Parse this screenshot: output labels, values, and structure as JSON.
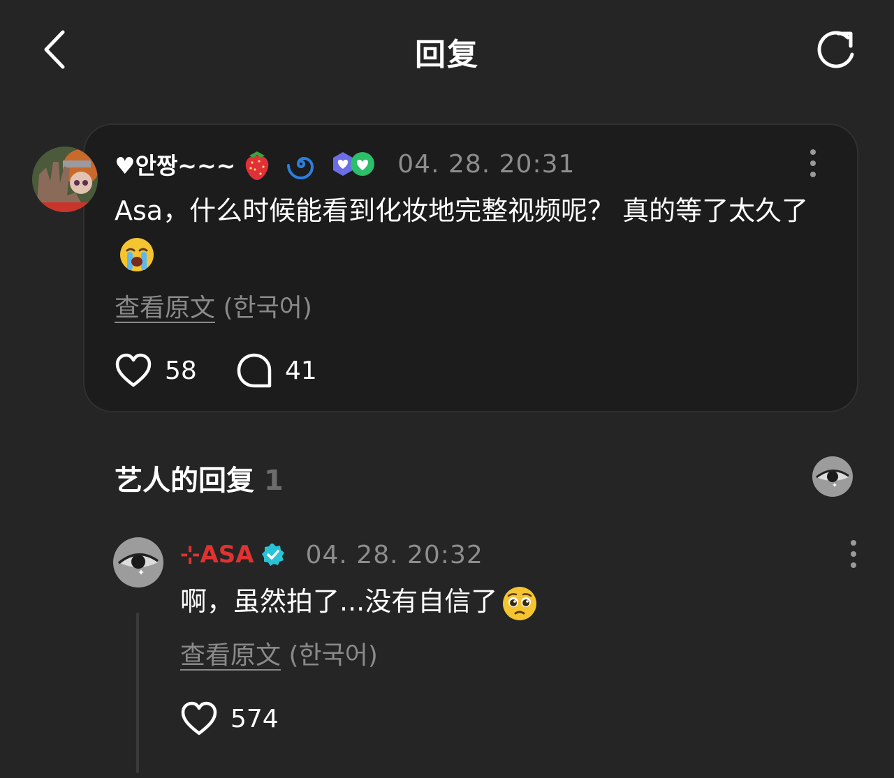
{
  "header": {
    "title": "回复"
  },
  "post": {
    "username": "♥안짱~~~",
    "timestamp": "04. 28. 20:31",
    "text": "Asa，什么时候能看到化妆地完整视频呢？ 真的等了太久了",
    "emoji": "loudly-crying-face",
    "view_original": "查看原文",
    "original_language": "(한국어)",
    "likes": "58",
    "comments": "41"
  },
  "artist_section": {
    "title": "艺人的回复",
    "count": "1"
  },
  "reply": {
    "username": "⊹ASA",
    "timestamp": "04. 28. 20:32",
    "text": "啊，虽然拍了...没有自信了",
    "emoji": "pleading-face",
    "view_original": "查看原文",
    "original_language": "(한국어)",
    "likes": "574"
  },
  "colors": {
    "background": "#252525",
    "card": "#1c1c1c",
    "muted": "#8d8d8d",
    "artist_name": "#e13232",
    "verified": "#29c3d8"
  }
}
